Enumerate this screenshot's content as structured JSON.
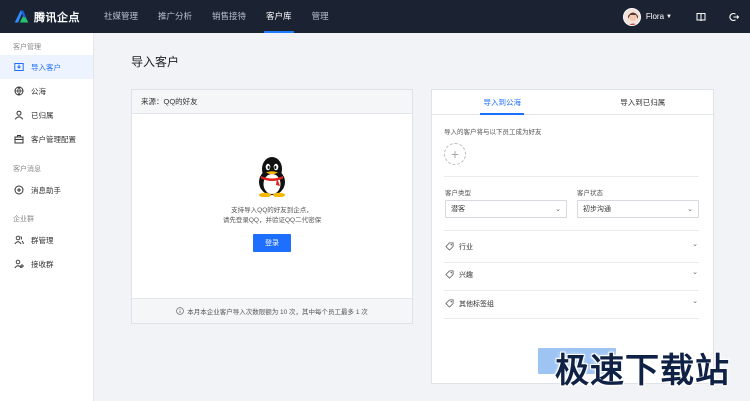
{
  "brand": {
    "name": "腾讯企点"
  },
  "nav": {
    "items": [
      "社媒管理",
      "推广分析",
      "销售接待",
      "客户库",
      "管理"
    ],
    "active_index": 3
  },
  "user": {
    "name": "Flora"
  },
  "sidebar": {
    "groups": [
      {
        "title": "客户管理",
        "items": [
          "导入客户",
          "公海",
          "已归属",
          "客户管理配置"
        ]
      },
      {
        "title": "客户消息",
        "items": [
          "消息助手"
        ]
      },
      {
        "title": "企业群",
        "items": [
          "群管理",
          "接收群"
        ]
      }
    ]
  },
  "page": {
    "title": "导入客户"
  },
  "left_card": {
    "header": "来源：QQ的好友",
    "line1": "支持导入QQ的好友到企点，",
    "line2": "请先登录QQ，并验证QQ二代密保",
    "login_label": "登录",
    "footer": "本月本企业客户导入次数限额为 10 次，其中每个员工最多 1 次"
  },
  "right_card": {
    "tabs": [
      "导入到公海",
      "导入到已归属"
    ],
    "active_tab": 0,
    "friend_hint": "导入的客户将与以下员工成为好友",
    "type_label": "客户类型",
    "type_value": "潜客",
    "status_label": "客户状态",
    "status_value": "初步沟通",
    "tag_groups": [
      "行业",
      "兴趣",
      "其他标签组"
    ]
  },
  "watermark": "极速下载站",
  "colors": {
    "accent": "#1f6fff",
    "topbar": "#1b2333"
  }
}
